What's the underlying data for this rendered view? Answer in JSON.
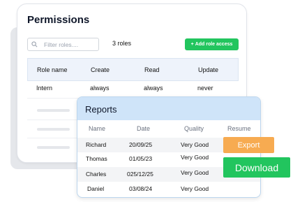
{
  "permissions": {
    "title": "Permissions",
    "search_placeholder": "Filter roles....",
    "roles_count": "3 roles",
    "add_button_label": "Add role access",
    "columns": [
      "Role name",
      "Create",
      "Read",
      "Update"
    ],
    "rows": [
      {
        "role": "Intern",
        "create": "always",
        "read": "always",
        "update": "never"
      }
    ]
  },
  "reports": {
    "title": "Reports",
    "columns": [
      "Name",
      "Date",
      "Quality",
      "Resume"
    ],
    "rows": [
      {
        "name": "Richard",
        "date": "20/09/25",
        "quality": "Very Good"
      },
      {
        "name": "Thomas",
        "date": "01/05/23",
        "quality": "Very Good"
      },
      {
        "name": "Charles",
        "date": "025/12/25",
        "quality": "Very Good"
      },
      {
        "name": "Daniel",
        "date": "03/08/24",
        "quality": "Very Good"
      }
    ],
    "export_label": "Export",
    "download_label": "Download"
  },
  "colors": {
    "accent_green": "#22c55e",
    "export_orange": "#f7ab51",
    "reports_header": "#cfe4f9"
  }
}
